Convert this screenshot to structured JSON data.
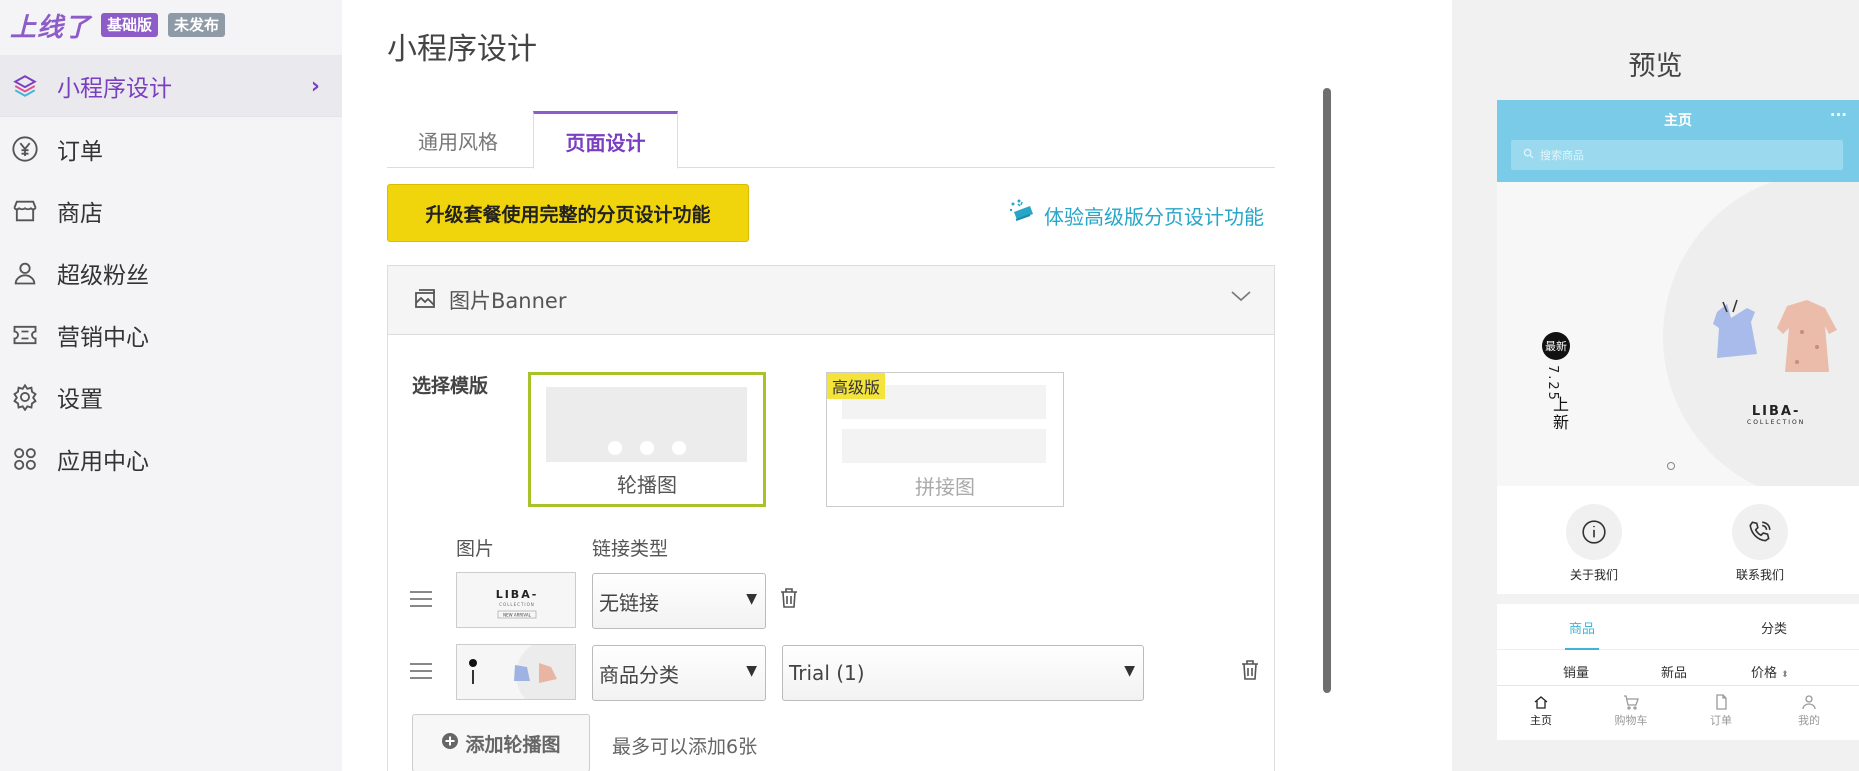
{
  "brand": {
    "logo": "上线了",
    "plan_badge": "基础版",
    "status_badge": "未发布"
  },
  "sidebar": {
    "items": [
      {
        "label": "小程序设计",
        "icon": "layers-icon",
        "active": true
      },
      {
        "label": "订单",
        "icon": "yuan-icon"
      },
      {
        "label": "商店",
        "icon": "store-icon"
      },
      {
        "label": "超级粉丝",
        "icon": "user-icon"
      },
      {
        "label": "营销中心",
        "icon": "ticket-icon"
      },
      {
        "label": "设置",
        "icon": "gear-icon"
      },
      {
        "label": "应用中心",
        "icon": "apps-icon"
      }
    ]
  },
  "main": {
    "title": "小程序设计",
    "tabs": [
      {
        "label": "通用风格"
      },
      {
        "label": "页面设计",
        "active": true
      }
    ],
    "upgrade_button": "升级套餐使用完整的分页设计功能",
    "try_link": "体验高级版分页设计功能",
    "panel": {
      "title": "图片Banner",
      "template_label": "选择模版",
      "templates": [
        {
          "label": "轮播图",
          "selected": true
        },
        {
          "label": "拼接图",
          "badge": "高级版"
        }
      ],
      "columns": {
        "image": "图片",
        "link_type": "链接类型"
      },
      "rows": [
        {
          "link_type": "无链接"
        },
        {
          "link_type": "商品分类",
          "target": "Trial (1)"
        }
      ],
      "add_button": "添加轮播图",
      "add_hint": "最多可以添加6张"
    }
  },
  "preview": {
    "title": "预览",
    "phone": {
      "page_title": "主页",
      "more": "···",
      "search_placeholder": "搜索商品",
      "banner": {
        "badge": "最新",
        "date": "7.25",
        "headline": "上新",
        "logo": "LIBA-",
        "logo_sub": "COLLECTION"
      },
      "links": [
        {
          "label": "关于我们",
          "icon": "info-icon"
        },
        {
          "label": "联系我们",
          "icon": "phone-icon"
        }
      ],
      "tabs": [
        "商品",
        "分类"
      ],
      "sort": [
        "销量",
        "新品",
        "价格"
      ],
      "bottom_nav": [
        {
          "label": "主页",
          "icon": "home-icon"
        },
        {
          "label": "购物车",
          "icon": "cart-icon"
        },
        {
          "label": "订单",
          "icon": "file-icon"
        },
        {
          "label": "我的",
          "icon": "user-icon"
        }
      ]
    }
  },
  "colors": {
    "accent": "#8d5cc9",
    "upgrade": "#f0d40c",
    "link": "#27a6c8",
    "phone_header": "#79cbe8"
  }
}
